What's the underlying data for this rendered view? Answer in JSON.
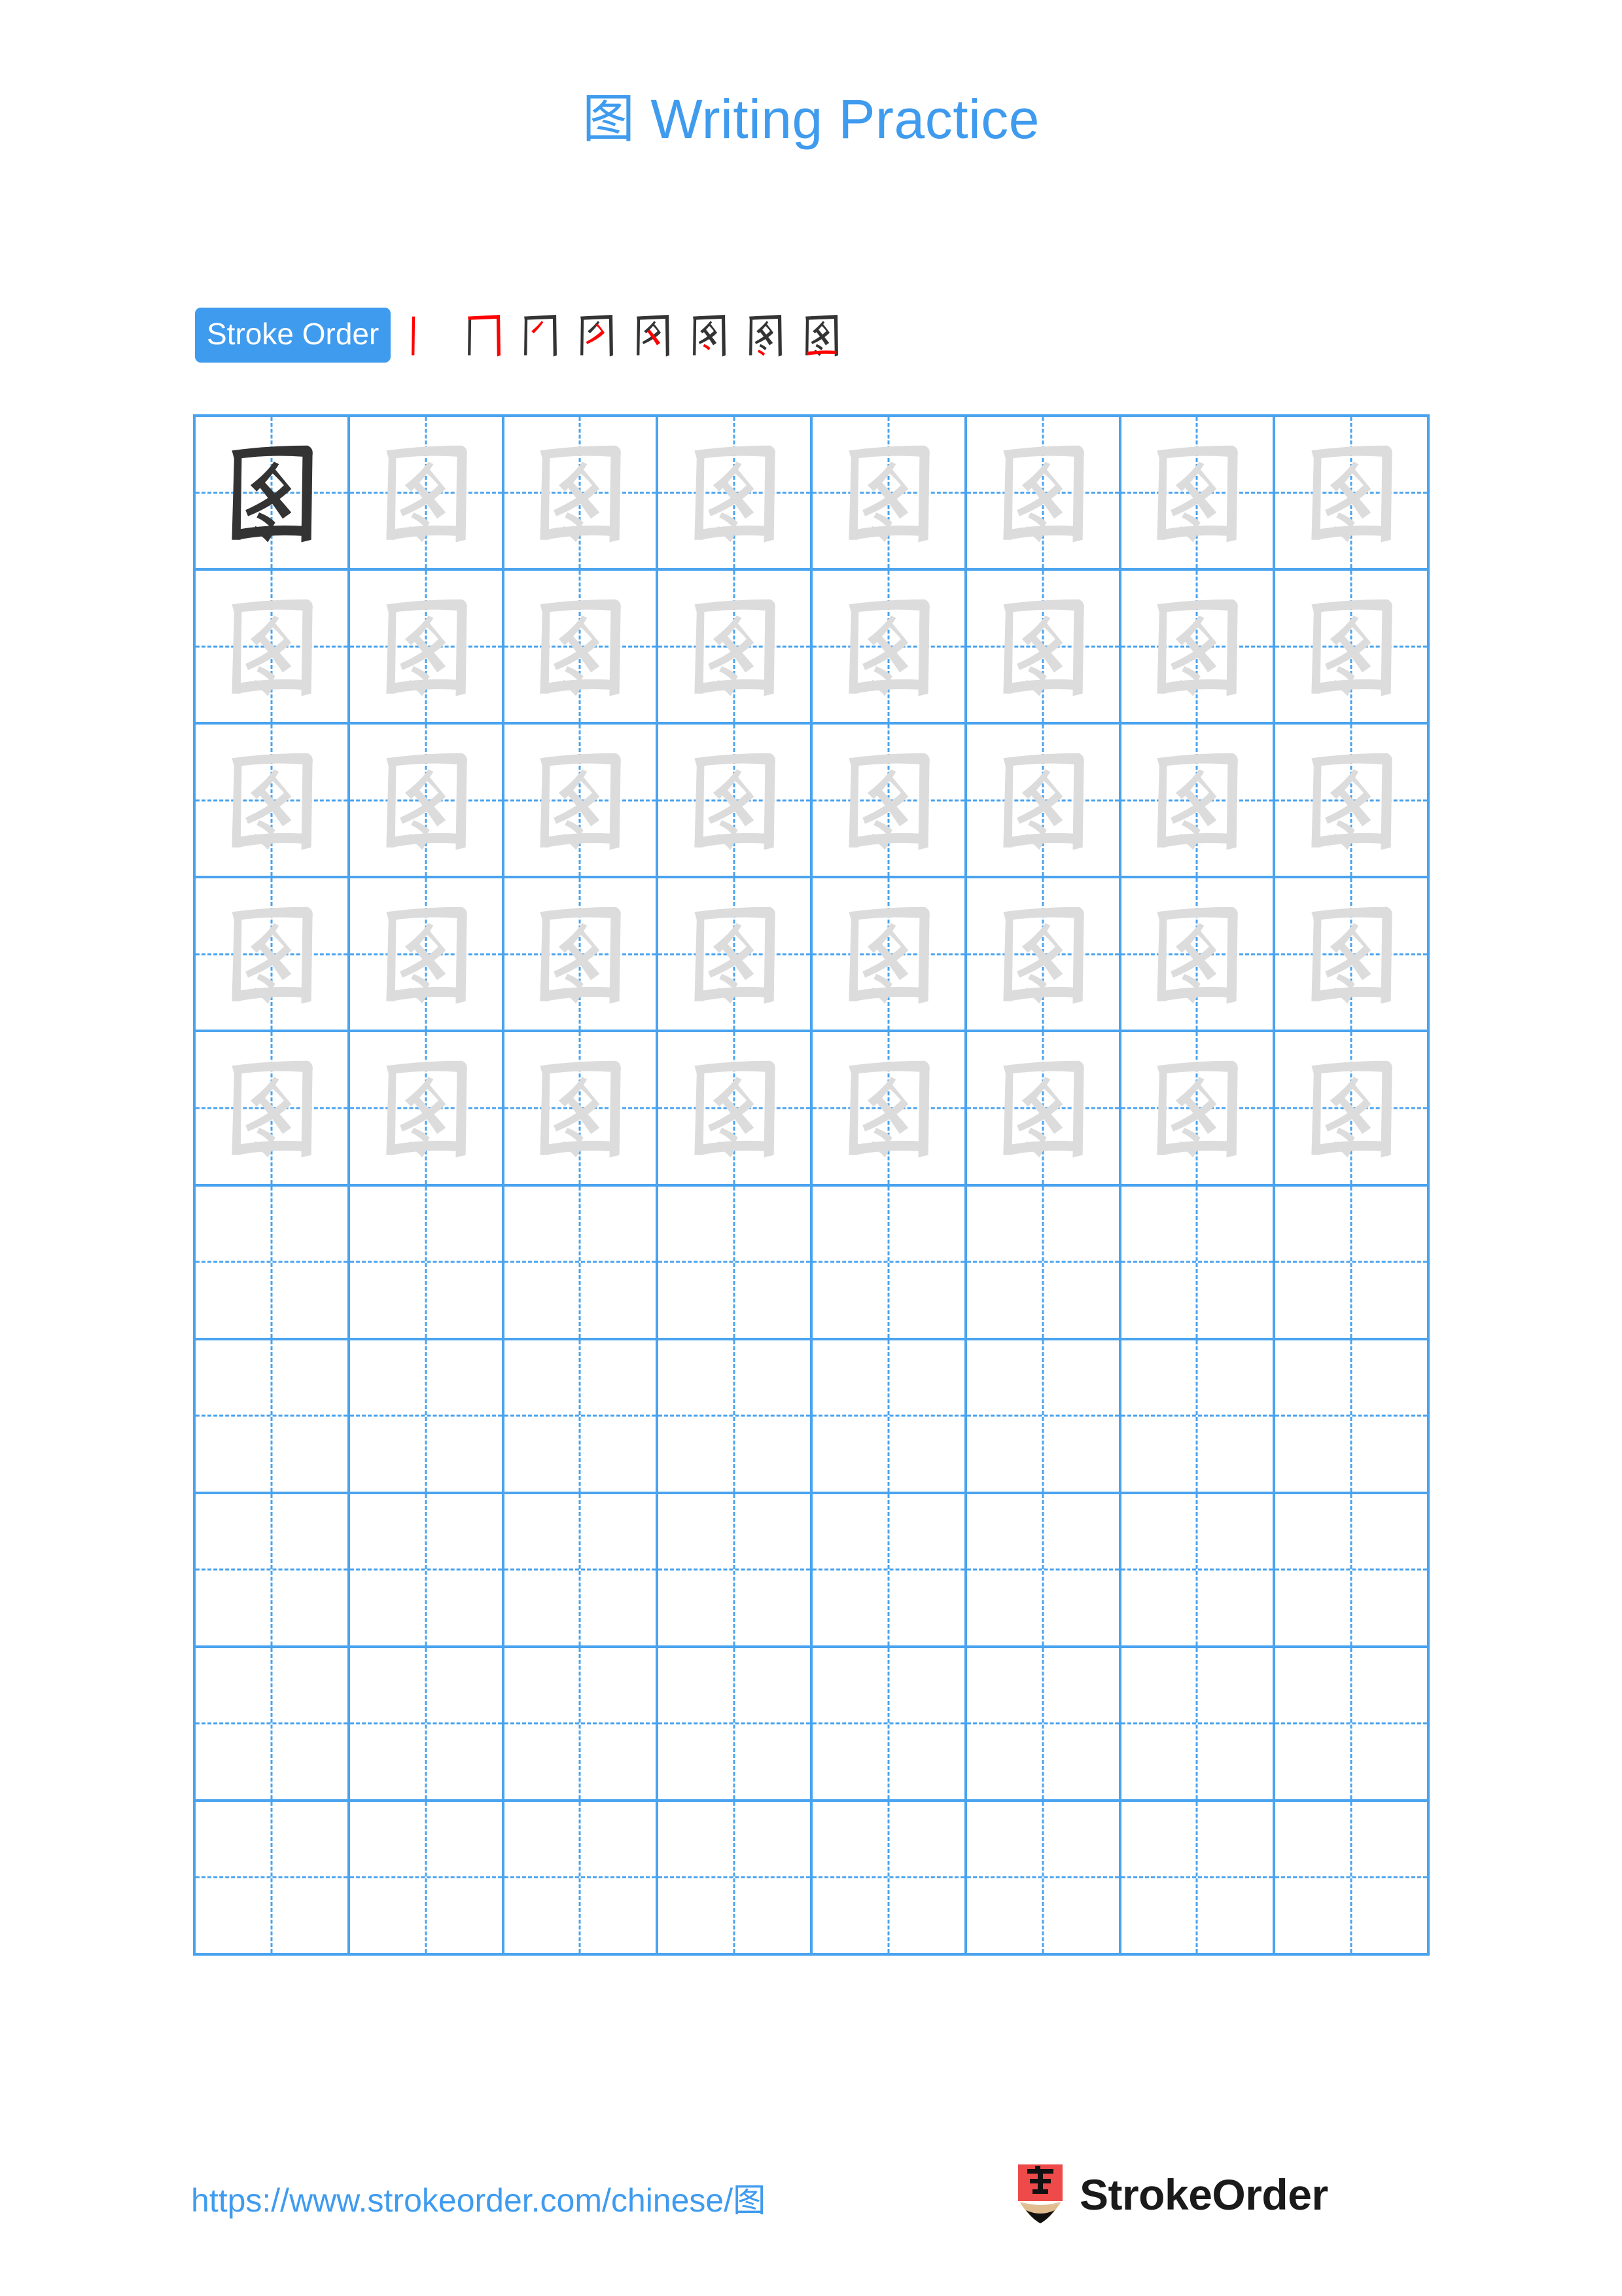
{
  "character": "图",
  "title": {
    "character": "图",
    "text": " Writing Practice",
    "full": "图 Writing Practice",
    "color": "#3f9bee"
  },
  "stroke_order": {
    "badge_label": "Stroke Order",
    "badge_bg": "#3f9bee",
    "badge_text_color": "#ffffff",
    "new_stroke_color": "#ff0000",
    "prior_stroke_color": "#333333",
    "total_strokes": 8,
    "steps": [
      {
        "index": 1,
        "partial": "丨",
        "new_stroke": "vertical-left"
      },
      {
        "index": 2,
        "partial": "冂",
        "new_stroke": "horizontal-top-and-vertical-right"
      },
      {
        "index": 3,
        "partial": "冋",
        "new_stroke": "short-slash-inner"
      },
      {
        "index": 4,
        "partial": "図",
        "new_stroke": "inner-downward-right"
      },
      {
        "index": 5,
        "partial": "図",
        "new_stroke": "inner-press-right"
      },
      {
        "index": 6,
        "partial": "図",
        "new_stroke": "dot-upper"
      },
      {
        "index": 7,
        "partial": "図",
        "new_stroke": "dot-lower"
      },
      {
        "index": 8,
        "partial": "图",
        "new_stroke": "bottom-horizontal-closing"
      }
    ]
  },
  "grid": {
    "columns": 8,
    "rows": 10,
    "line_color": "#4aa3ef",
    "guide_color": "#4aa3ef",
    "traced_character_color": "#dcdcdc",
    "model_character_color": "#333333",
    "rows_detail": [
      {
        "row": 1,
        "cells": [
          "model",
          "trace",
          "trace",
          "trace",
          "trace",
          "trace",
          "trace",
          "trace"
        ]
      },
      {
        "row": 2,
        "cells": [
          "trace",
          "trace",
          "trace",
          "trace",
          "trace",
          "trace",
          "trace",
          "trace"
        ]
      },
      {
        "row": 3,
        "cells": [
          "trace",
          "trace",
          "trace",
          "trace",
          "trace",
          "trace",
          "trace",
          "trace"
        ]
      },
      {
        "row": 4,
        "cells": [
          "trace",
          "trace",
          "trace",
          "trace",
          "trace",
          "trace",
          "trace",
          "trace"
        ]
      },
      {
        "row": 5,
        "cells": [
          "trace",
          "trace",
          "trace",
          "trace",
          "trace",
          "trace",
          "trace",
          "trace"
        ]
      },
      {
        "row": 6,
        "cells": [
          "empty",
          "empty",
          "empty",
          "empty",
          "empty",
          "empty",
          "empty",
          "empty"
        ]
      },
      {
        "row": 7,
        "cells": [
          "empty",
          "empty",
          "empty",
          "empty",
          "empty",
          "empty",
          "empty",
          "empty"
        ]
      },
      {
        "row": 8,
        "cells": [
          "empty",
          "empty",
          "empty",
          "empty",
          "empty",
          "empty",
          "empty",
          "empty"
        ]
      },
      {
        "row": 9,
        "cells": [
          "empty",
          "empty",
          "empty",
          "empty",
          "empty",
          "empty",
          "empty",
          "empty"
        ]
      },
      {
        "row": 10,
        "cells": [
          "empty",
          "empty",
          "empty",
          "empty",
          "empty",
          "empty",
          "empty",
          "empty"
        ]
      }
    ]
  },
  "footer": {
    "url": "https://www.strokeorder.com/chinese/图",
    "url_color": "#3f9bee",
    "brand_name": "StrokeOrder",
    "logo_character": "字",
    "logo_body_color": "#ee4a4a",
    "logo_wood_color": "#e0bc8e",
    "logo_tip_color": "#111111"
  }
}
